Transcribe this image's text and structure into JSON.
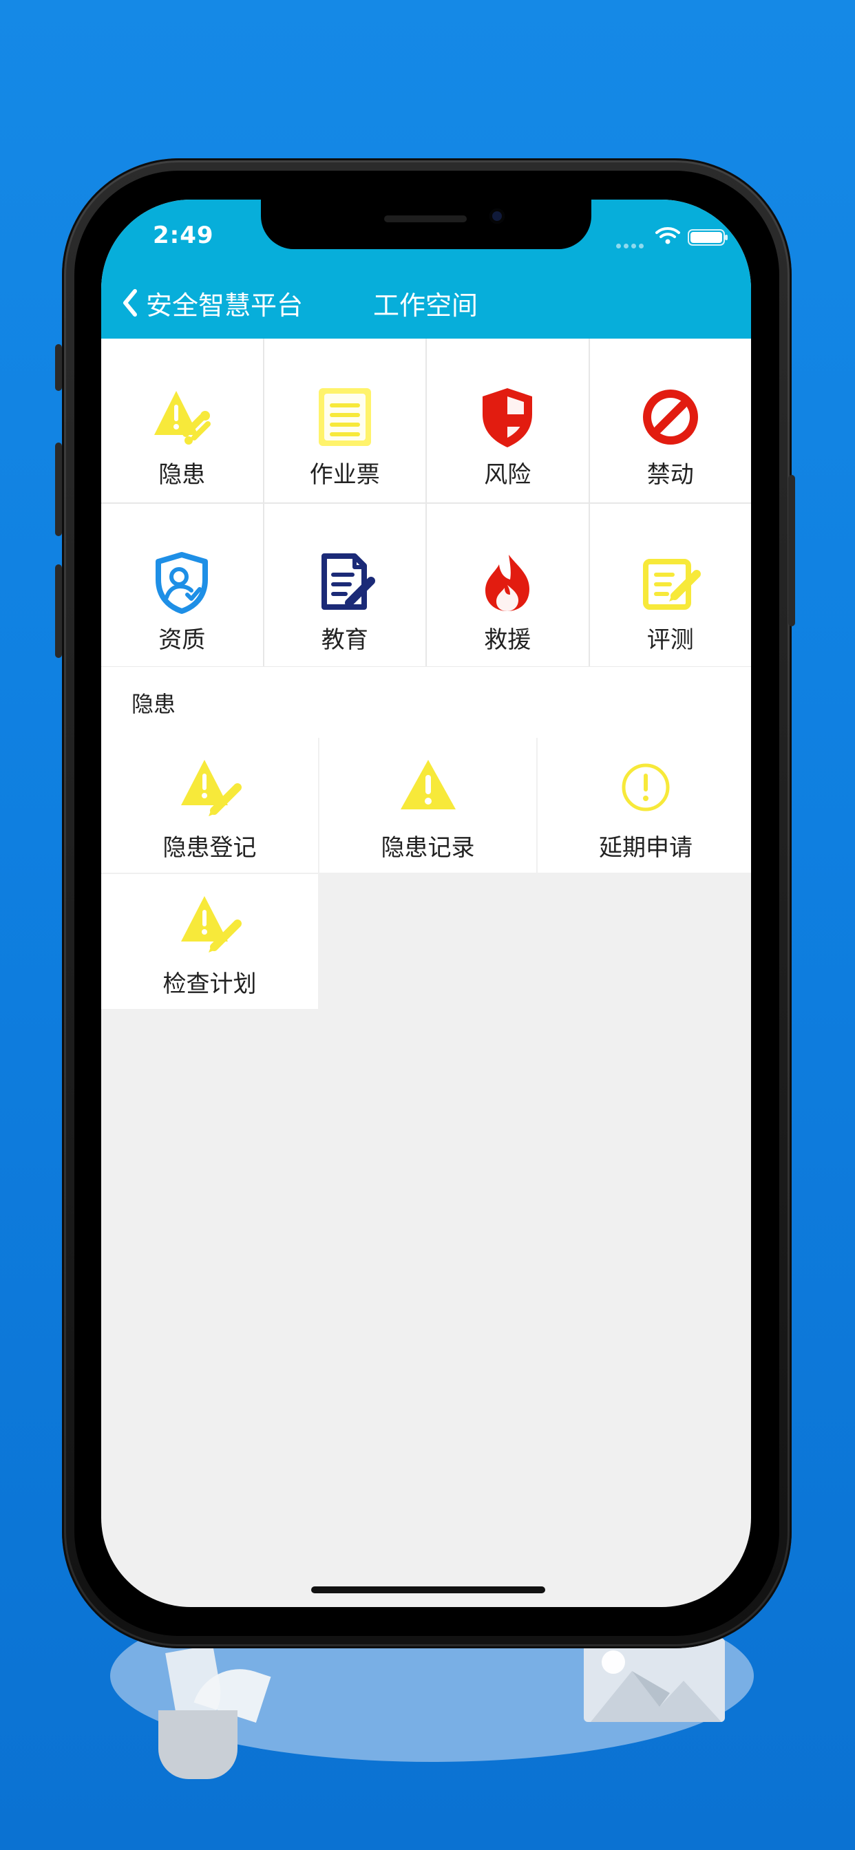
{
  "status_bar": {
    "time": "2:49"
  },
  "header": {
    "back_label": "安全智慧平台",
    "title": "工作空间"
  },
  "main_menu": [
    {
      "label": "隐患",
      "icon": "warning-tools-icon"
    },
    {
      "label": "作业票",
      "icon": "document-lines-icon"
    },
    {
      "label": "风险",
      "icon": "shield-risk-icon"
    },
    {
      "label": "禁动",
      "icon": "prohibited-icon"
    },
    {
      "label": "资质",
      "icon": "certified-user-shield-icon"
    },
    {
      "label": "教育",
      "icon": "education-document-pen-icon"
    },
    {
      "label": "救援",
      "icon": "fire-icon"
    },
    {
      "label": "评测",
      "icon": "evaluation-note-pen-icon"
    }
  ],
  "section": {
    "title": "隐患"
  },
  "sub_menu": [
    {
      "label": "隐患登记",
      "icon": "warning-pen-icon"
    },
    {
      "label": "隐患记录",
      "icon": "warning-icon"
    },
    {
      "label": "延期申请",
      "icon": "exclamation-circle-icon"
    },
    {
      "label": "检查计划",
      "icon": "warning-pen-icon"
    }
  ],
  "colors": {
    "background_blue": "#1589e6",
    "header_teal": "#07aeda",
    "yellow": "#f7e93a",
    "red": "#e21c10",
    "navy": "#1b2a77",
    "blue": "#1e8fe6"
  }
}
